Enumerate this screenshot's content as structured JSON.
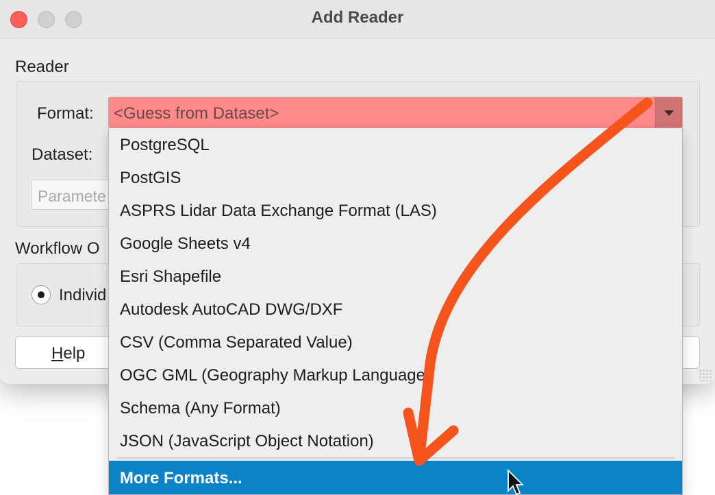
{
  "window": {
    "title": "Add Reader"
  },
  "reader": {
    "section_label": "Reader",
    "format_label": "Format:",
    "format_value": "<Guess from Dataset>",
    "dataset_label": "Dataset:",
    "parameters_placeholder": "Paramete"
  },
  "workflow": {
    "section_label": "Workflow O",
    "radio_label": "Individ"
  },
  "buttons": {
    "help_label_first": "H",
    "help_label_rest": "elp"
  },
  "dropdown": {
    "options": [
      "PostgreSQL",
      "PostGIS",
      "ASPRS Lidar Data Exchange Format (LAS)",
      "Google Sheets v4",
      "Esri Shapefile",
      "Autodesk AutoCAD DWG/DXF",
      "CSV (Comma Separated Value)",
      "OGC GML (Geography Markup Language)",
      "Schema (Any Format)",
      "JSON (JavaScript Object Notation)"
    ],
    "more_label": "More Formats..."
  },
  "colors": {
    "combo_invalid_bg": "#ff8a8a",
    "highlight": "#0a84c6",
    "annotation_arrow": "#f5541c",
    "close_button": "#ff5f57"
  },
  "icons": [
    "close-icon",
    "minimize-icon",
    "zoom-icon",
    "chevron-down-icon",
    "mouse-pointer-icon",
    "resize-grip-icon"
  ]
}
